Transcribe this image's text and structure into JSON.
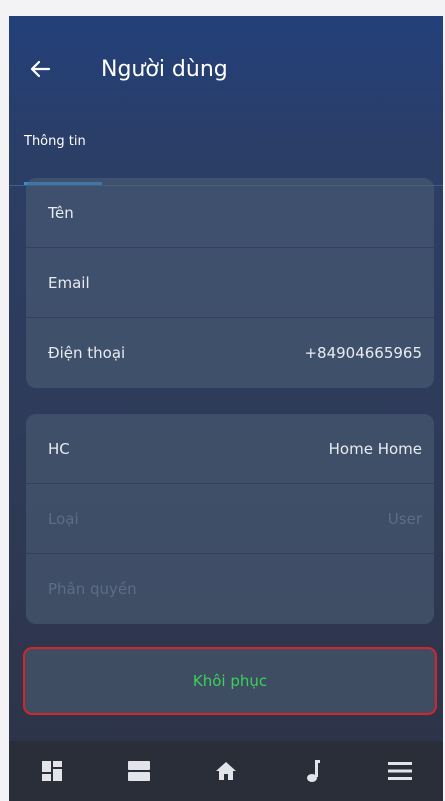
{
  "header": {
    "title": "Người dùng",
    "tab_label": "Thông tin",
    "back_icon": "arrow-left-icon"
  },
  "info_group": [
    {
      "label": "Tên",
      "value": ""
    },
    {
      "label": "Email",
      "value": ""
    },
    {
      "label": "Điện thoại",
      "value": "+84904665965"
    }
  ],
  "home_group": [
    {
      "label": "HC",
      "value": "Home Home"
    },
    {
      "label": "Loại",
      "value": "User"
    },
    {
      "label": "Phân quyền",
      "value": ""
    }
  ],
  "restore_button": {
    "label": "Khôi phục"
  },
  "bottom_nav": {
    "items": [
      "dashboard-icon",
      "list-icon",
      "home-icon",
      "music-icon",
      "menu-icon"
    ]
  },
  "colors": {
    "accent_tab": "#2f8fe3",
    "restore_text": "#3ad15a",
    "restore_border": "#d2262a",
    "nav_bg": "#2a2e39"
  }
}
